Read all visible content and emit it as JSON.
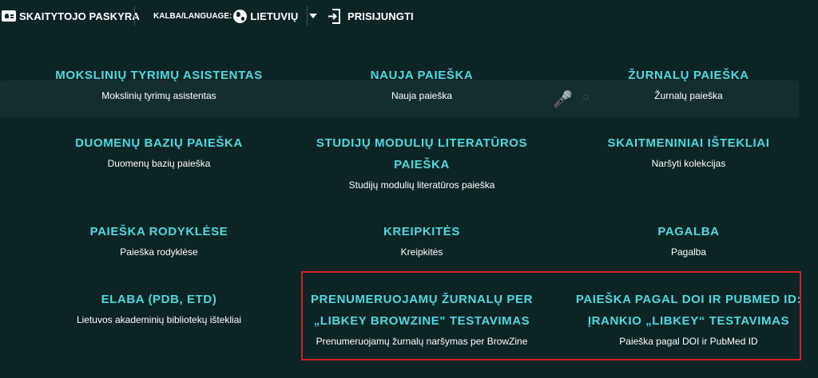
{
  "topbar": {
    "account": "SKAITYTOJO PASKYRA",
    "language_prefix": "KALBA/LANGUAGE:",
    "language_value": "LIETUVIŲ",
    "login": "PRISIJUNGTI",
    "icons": [
      "id-card-icon",
      "globe-icon",
      "caret-down-icon",
      "sign-in-icon"
    ]
  },
  "menu": [
    {
      "title": "MOKSLINIŲ TYRIMŲ ASISTENTAS",
      "subtitle": "Mokslinių tyrimų asistentas"
    },
    {
      "title": "NAUJA PAIEŠKA",
      "subtitle": "Nauja paieška"
    },
    {
      "title": "ŽURNALŲ PAIEŠKA",
      "subtitle": "Žurnalų paieška"
    },
    {
      "title": "DUOMENŲ BAZIŲ PAIEŠKA",
      "subtitle": "Duomenų bazių paieška"
    },
    {
      "title": "STUDIJŲ MODULIŲ LITERATŪROS PAIEŠKA",
      "subtitle": "Studijų modulių literatūros paieška"
    },
    {
      "title": "SKAITMENINIAI IŠTEKLIAI",
      "subtitle": "Naršyti kolekcijas"
    },
    {
      "title": "PAIEŠKA RODYKLĖSE",
      "subtitle": "Paieška rodyklėse"
    },
    {
      "title": "KREIPKITĖS",
      "subtitle": "Kreipkitės"
    },
    {
      "title": "PAGALBA",
      "subtitle": "Pagalba"
    },
    {
      "title": "ELABA (PDB, ETD)",
      "subtitle": "Lietuvos akademinių bibliotekų ištekliai"
    },
    {
      "title": "PRENUMERUOJAMŲ ŽURNALŲ PER „LIBKEY BROWZINE\" TESTAVIMAS",
      "subtitle": "Prenumeruojamų žurnalų naršymas per BrowZine"
    },
    {
      "title": "PAIEŠKA PAGAL DOI IR PUBMED ID: ĮRANKIO „LIBKEY“ TESTAVIMAS",
      "subtitle": "Paieška pagal DOI ir PubMed ID"
    }
  ],
  "colors": {
    "background": "#0c2424",
    "link": "#4fd9e0",
    "highlight": "#d01f27"
  }
}
